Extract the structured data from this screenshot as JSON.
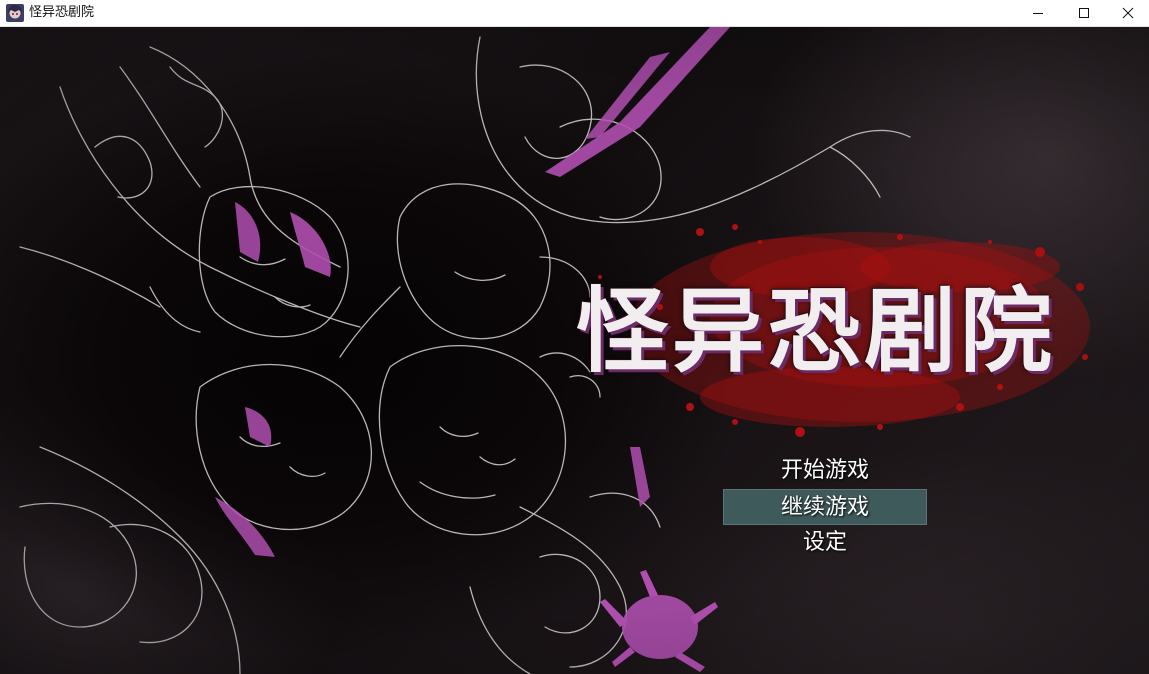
{
  "window": {
    "title": "怪异恐剧院",
    "controls": [
      "minimize-icon",
      "maximize-icon",
      "close-icon"
    ]
  },
  "game": {
    "logo_text": "怪异恐剧院",
    "menu": {
      "items": [
        {
          "label": "开始游戏",
          "selected": false
        },
        {
          "label": "继续游戏",
          "selected": true
        },
        {
          "label": "设定",
          "selected": false
        }
      ]
    }
  },
  "colors": {
    "selection": "#3f5a5b",
    "accent_purple": "#b04fb0",
    "blood_red": "#b01010",
    "lineart": "#d8d4d6"
  }
}
